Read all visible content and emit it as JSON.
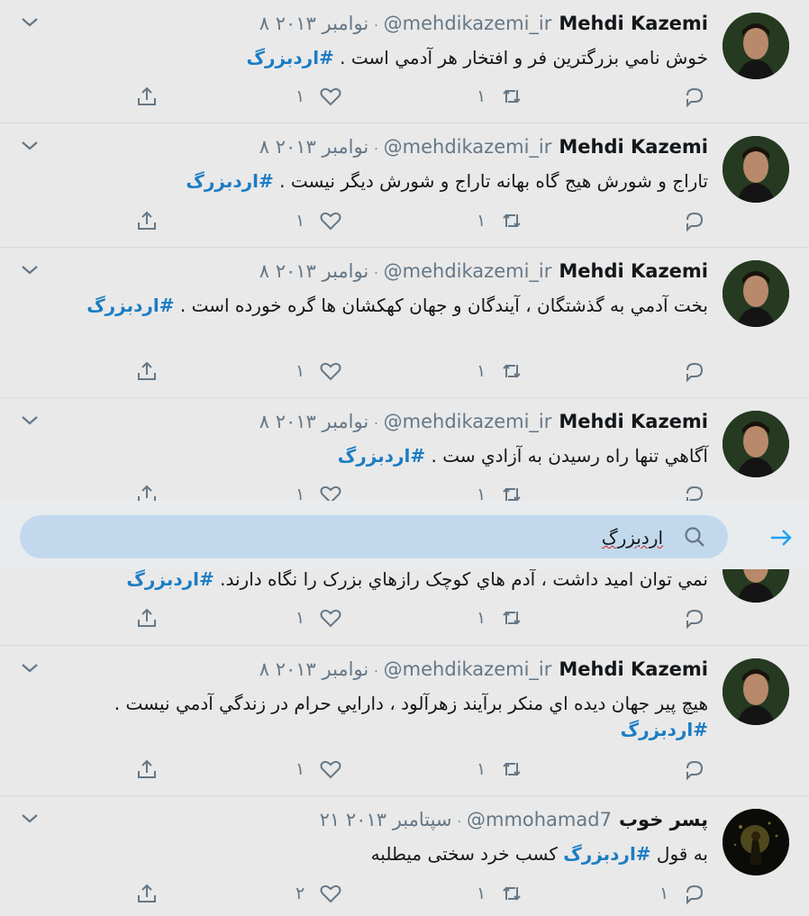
{
  "tweets": [
    {
      "name": "Mehdi Kazemi",
      "handle": "@mehdikazemi_ir",
      "date": "۸ نوامبر ۲۰۱۳",
      "text": "خوش نامي بزرگترين فر و افتخار هر آدمي است . ",
      "hashtag": "#اردبزرگ",
      "reply_count": "",
      "retweet_count": "۱",
      "like_count": "۱"
    },
    {
      "name": "Mehdi Kazemi",
      "handle": "@mehdikazemi_ir",
      "date": "۸ نوامبر ۲۰۱۳",
      "text": "تاراج و شورش هيج گاه بهانه تاراج  و شورش ديگر نيست . ",
      "hashtag": "#اردبزرگ",
      "reply_count": "",
      "retweet_count": "۱",
      "like_count": "۱"
    },
    {
      "name": "Mehdi Kazemi",
      "handle": "@mehdikazemi_ir",
      "date": "۸ نوامبر ۲۰۱۳",
      "text": "بخت آدمي به گذشتگان ، آيندگان و جهان کهکشان ها گره خورده است . ",
      "hashtag": "#اردبزرگ",
      "reply_count": "",
      "retweet_count": "۱",
      "like_count": "۱"
    },
    {
      "name": "Mehdi Kazemi",
      "handle": "@mehdikazemi_ir",
      "date": "۸ نوامبر ۲۰۱۳",
      "text": "آگاهي تنها راه رسيدن به آزادي ست . ",
      "hashtag": "#اردبزرگ",
      "reply_count": "",
      "retweet_count": "۱",
      "like_count": "۱"
    },
    {
      "name": "",
      "handle": "",
      "date": "",
      "text": "نمي توان اميد داشت ، آدم هاي کوچک رازهاي بزرک را نگاه دارند. ",
      "hashtag": "#اردبزرگ",
      "reply_count": "",
      "retweet_count": "۱",
      "like_count": "۱"
    },
    {
      "name": "Mehdi Kazemi",
      "handle": "@mehdikazemi_ir",
      "date": "۸ نوامبر ۲۰۱۳",
      "text": "هيچ پير جهان ديده اي منکر برآيند زهرآلود ، دارايي حرام در زندگي آدمي نيست . ",
      "hashtag": "#اردبزرگ",
      "reply_count": "",
      "retweet_count": "۱",
      "like_count": "۱"
    },
    {
      "name": "پسر خوب",
      "handle": "@mmohamad7",
      "date": "۲۱ سپتامبر ۲۰۱۳",
      "text_before": "به قول ",
      "hashtag": "#اردبزرگ",
      "text_after": " کسب خرد سختی میطلبه",
      "reply_count": "۱",
      "retweet_count": "۱",
      "like_count": "۲"
    }
  ],
  "search": {
    "query": "اردبزرگ"
  },
  "icons": {
    "reply": "reply-icon",
    "retweet": "retweet-icon",
    "like": "heart-icon",
    "share": "share-icon",
    "search": "search-icon",
    "go": "arrow-right-icon",
    "caret": "chevron-down-icon"
  },
  "colors": {
    "hashtag": "#1b7dc4",
    "meta": "#657786",
    "search_field": "#c2d9ed",
    "go_arrow": "#1da1f2"
  }
}
